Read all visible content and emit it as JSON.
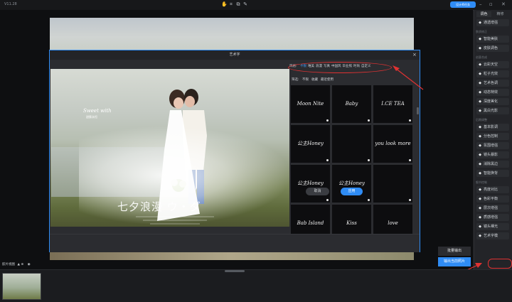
{
  "app": {
    "version": "V11.28",
    "badge": "设计师任务"
  },
  "top_toolbar": {
    "icons": [
      "hand-icon",
      "crop-icon",
      "copy-icon",
      "pen-icon"
    ]
  },
  "right_panel": {
    "tabs": [
      "调色",
      "精修"
    ],
    "sections": [
      {
        "label": "",
        "items": [
          {
            "icon": "star-icon",
            "label": "通透增强"
          }
        ]
      },
      {
        "label": "肤质修正",
        "items": [
          {
            "icon": "sparkle-icon",
            "label": "智能美肤"
          },
          {
            "icon": "circle-icon",
            "label": "皮肤调色"
          }
        ]
      },
      {
        "label": "创意合成",
        "items": [
          {
            "icon": "cloud-icon",
            "label": "云彩天空"
          },
          {
            "icon": "particle-icon",
            "label": "粒子光效"
          },
          {
            "icon": "palette-icon",
            "label": "艺术色调"
          },
          {
            "icon": "wave-icon",
            "label": "动态特效"
          },
          {
            "icon": "depth-icon",
            "label": "深度美化"
          },
          {
            "icon": "bw-icon",
            "label": "黑白光影"
          }
        ]
      },
      {
        "label": "后期调整",
        "items": [
          {
            "icon": "sliders-icon",
            "label": "基本影调"
          },
          {
            "icon": "split-icon",
            "label": "分色控制"
          },
          {
            "icon": "filter-icon",
            "label": "氛围增强"
          },
          {
            "icon": "lens-icon",
            "label": "镜头暴影"
          },
          {
            "icon": "scissors-icon",
            "label": "消除黑边"
          },
          {
            "icon": "ai-icon",
            "label": "智能换背"
          }
        ]
      },
      {
        "label": "细节控制",
        "items": [
          {
            "icon": "contrast-icon",
            "label": "亮度对比"
          },
          {
            "icon": "balance-icon",
            "label": "色彩平衡"
          },
          {
            "icon": "layers-icon",
            "label": "层次增强"
          },
          {
            "icon": "detail-icon",
            "label": "质感增强"
          },
          {
            "icon": "lens-flare-icon",
            "label": "镜头裸光"
          },
          {
            "icon": "text-a-icon",
            "label": "艺术字模"
          }
        ]
      }
    ]
  },
  "dialog": {
    "title": "艺术字",
    "style_label": "风格:",
    "styles": [
      "不限",
      "唯美",
      "浪漫",
      "写真",
      "中国风",
      "毕业照",
      "时尚",
      "自定义"
    ],
    "active_style": "不限",
    "filter_label": "筛选:",
    "filters": [
      "不限",
      "收藏",
      "最近使用"
    ],
    "watermark": {
      "small": "Sweet with",
      "sub": "甜蜜永恒",
      "big": "七夕浪漫 ウ・ダ"
    },
    "tiles": [
      {
        "text": "Moon Nite"
      },
      {
        "text": "Baby"
      },
      {
        "text": "I.CE TEA"
      },
      {
        "text": "公主Honey"
      },
      {
        "text": ""
      },
      {
        "text": "you look more today"
      },
      {
        "text": "公主Honey"
      },
      {
        "text": "公主Honey"
      },
      {
        "text": ""
      },
      {
        "text": "Bab Island"
      },
      {
        "text": "Kiss"
      },
      {
        "text": "love"
      },
      {
        "text": ""
      },
      {
        "text": ""
      },
      {
        "text": ""
      }
    ],
    "cancel_label": "取消",
    "ok_label": "应用"
  },
  "bottom": {
    "batch_label": "批量输出",
    "export_label": "输出当前照片",
    "filmstrip_label": "胶片视图"
  }
}
